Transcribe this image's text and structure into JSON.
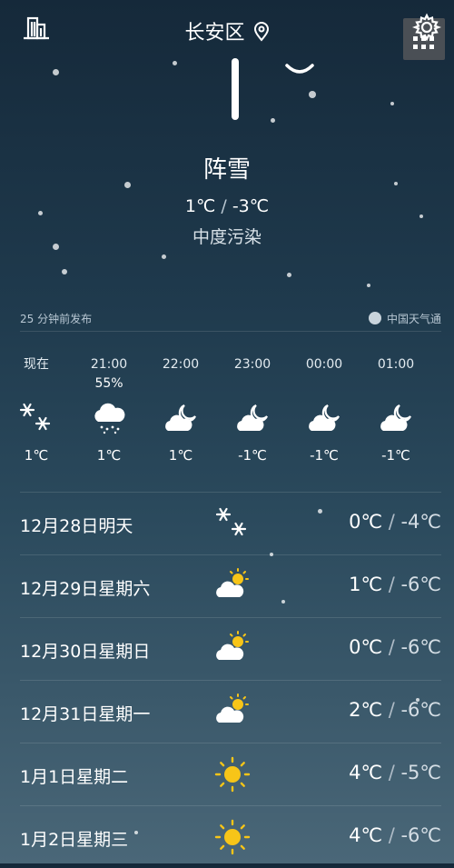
{
  "header": {
    "location": "长安区",
    "icons": [
      "city-list-icon",
      "location-pin-icon",
      "grid-menu-icon",
      "gear-icon"
    ]
  },
  "current": {
    "condition": "阵雪",
    "high": "1℃",
    "sep": " / ",
    "low": "-3℃",
    "aqi": "中度污染"
  },
  "publish": {
    "time_text": "25 分钟前发布",
    "source": "中国天气通"
  },
  "hourly": [
    {
      "time": "现在",
      "pop": "",
      "icon": "snow-icon",
      "temp": "1℃"
    },
    {
      "time": "21:00",
      "pop": "55%",
      "icon": "cloud-snow-icon",
      "temp": "1℃"
    },
    {
      "time": "22:00",
      "pop": "",
      "icon": "cloud-moon-icon",
      "temp": "1℃"
    },
    {
      "time": "23:00",
      "pop": "",
      "icon": "cloud-moon-icon",
      "temp": "-1℃"
    },
    {
      "time": "00:00",
      "pop": "",
      "icon": "cloud-moon-icon",
      "temp": "-1℃"
    },
    {
      "time": "01:00",
      "pop": "",
      "icon": "cloud-moon-icon",
      "temp": "-1℃"
    }
  ],
  "daily": [
    {
      "date": "12月28日明天",
      "icon": "snow-icon",
      "high": "0℃",
      "low": "-4℃"
    },
    {
      "date": "12月29日星期六",
      "icon": "partly-cloudy-icon",
      "high": "1℃",
      "low": "-6℃"
    },
    {
      "date": "12月30日星期日",
      "icon": "partly-cloudy-icon",
      "high": "0℃",
      "low": "-6℃"
    },
    {
      "date": "12月31日星期一",
      "icon": "partly-cloudy-icon",
      "high": "2℃",
      "low": "-6℃"
    },
    {
      "date": "1月1日星期二",
      "icon": "sun-icon",
      "high": "4℃",
      "low": "-5℃"
    },
    {
      "date": "1月2日星期三",
      "icon": "sun-icon",
      "high": "4℃",
      "low": "-6℃"
    }
  ],
  "colors": {
    "sun": "#f7c518",
    "bg_top": "#15293a",
    "bg_bottom": "#4a6778"
  }
}
